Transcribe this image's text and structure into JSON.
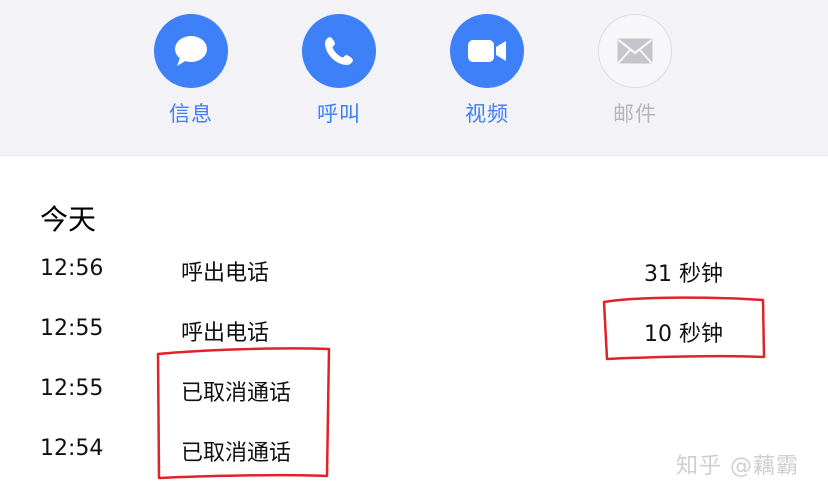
{
  "actions": [
    {
      "label": "信息",
      "icon": "message-bubble-icon",
      "enabled": true
    },
    {
      "label": "呼叫",
      "icon": "phone-icon",
      "enabled": true
    },
    {
      "label": "视频",
      "icon": "video-camera-icon",
      "enabled": true
    },
    {
      "label": "邮件",
      "icon": "mail-envelope-icon",
      "enabled": false
    }
  ],
  "calls": {
    "section_title": "今天",
    "rows": [
      {
        "time": "12:56",
        "kind": "呼出电话",
        "duration": "31 秒钟"
      },
      {
        "time": "12:55",
        "kind": "呼出电话",
        "duration": "10 秒钟"
      },
      {
        "time": "12:55",
        "kind": "已取消通话",
        "duration": ""
      },
      {
        "time": "12:54",
        "kind": "已取消通话",
        "duration": ""
      }
    ]
  },
  "watermark": "知乎 @藕霸",
  "colors": {
    "accent": "#3d80f7",
    "disabled": "#b5b5bb",
    "panel_bg": "#f2f2f7",
    "annotation": "#e0222a"
  }
}
